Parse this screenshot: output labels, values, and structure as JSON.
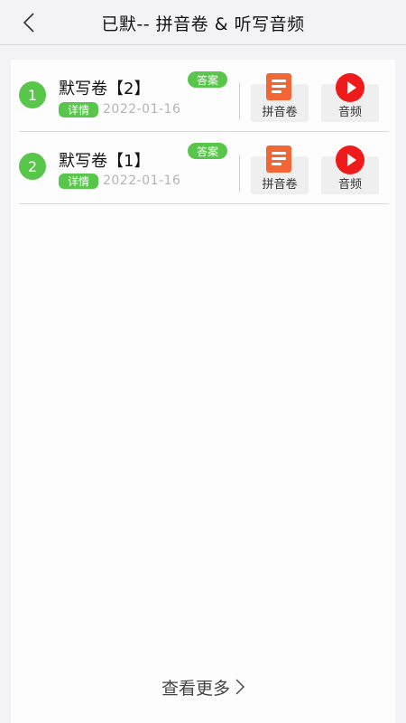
{
  "header": {
    "title": "已默-- 拼音卷 & 听写音频"
  },
  "items": [
    {
      "index": "1",
      "title": "默写卷【2】",
      "answer_tag": "答案",
      "detail_tag": "详情",
      "date": "2022-01-16",
      "pinyin_label": "拼音卷",
      "audio_label": "音频"
    },
    {
      "index": "2",
      "title": "默写卷【1】",
      "answer_tag": "答案",
      "detail_tag": "详情",
      "date": "2022-01-16",
      "pinyin_label": "拼音卷",
      "audio_label": "音频"
    }
  ],
  "footer": {
    "more_label": "查看更多"
  },
  "icons": {
    "back": "chevron-left-icon",
    "pinyin": "document-icon",
    "audio": "play-icon",
    "more": "chevron-right-icon"
  },
  "colors": {
    "accent_green": "#58c64a",
    "doc_orange": "#f26534",
    "play_red": "#ef1b1b"
  }
}
